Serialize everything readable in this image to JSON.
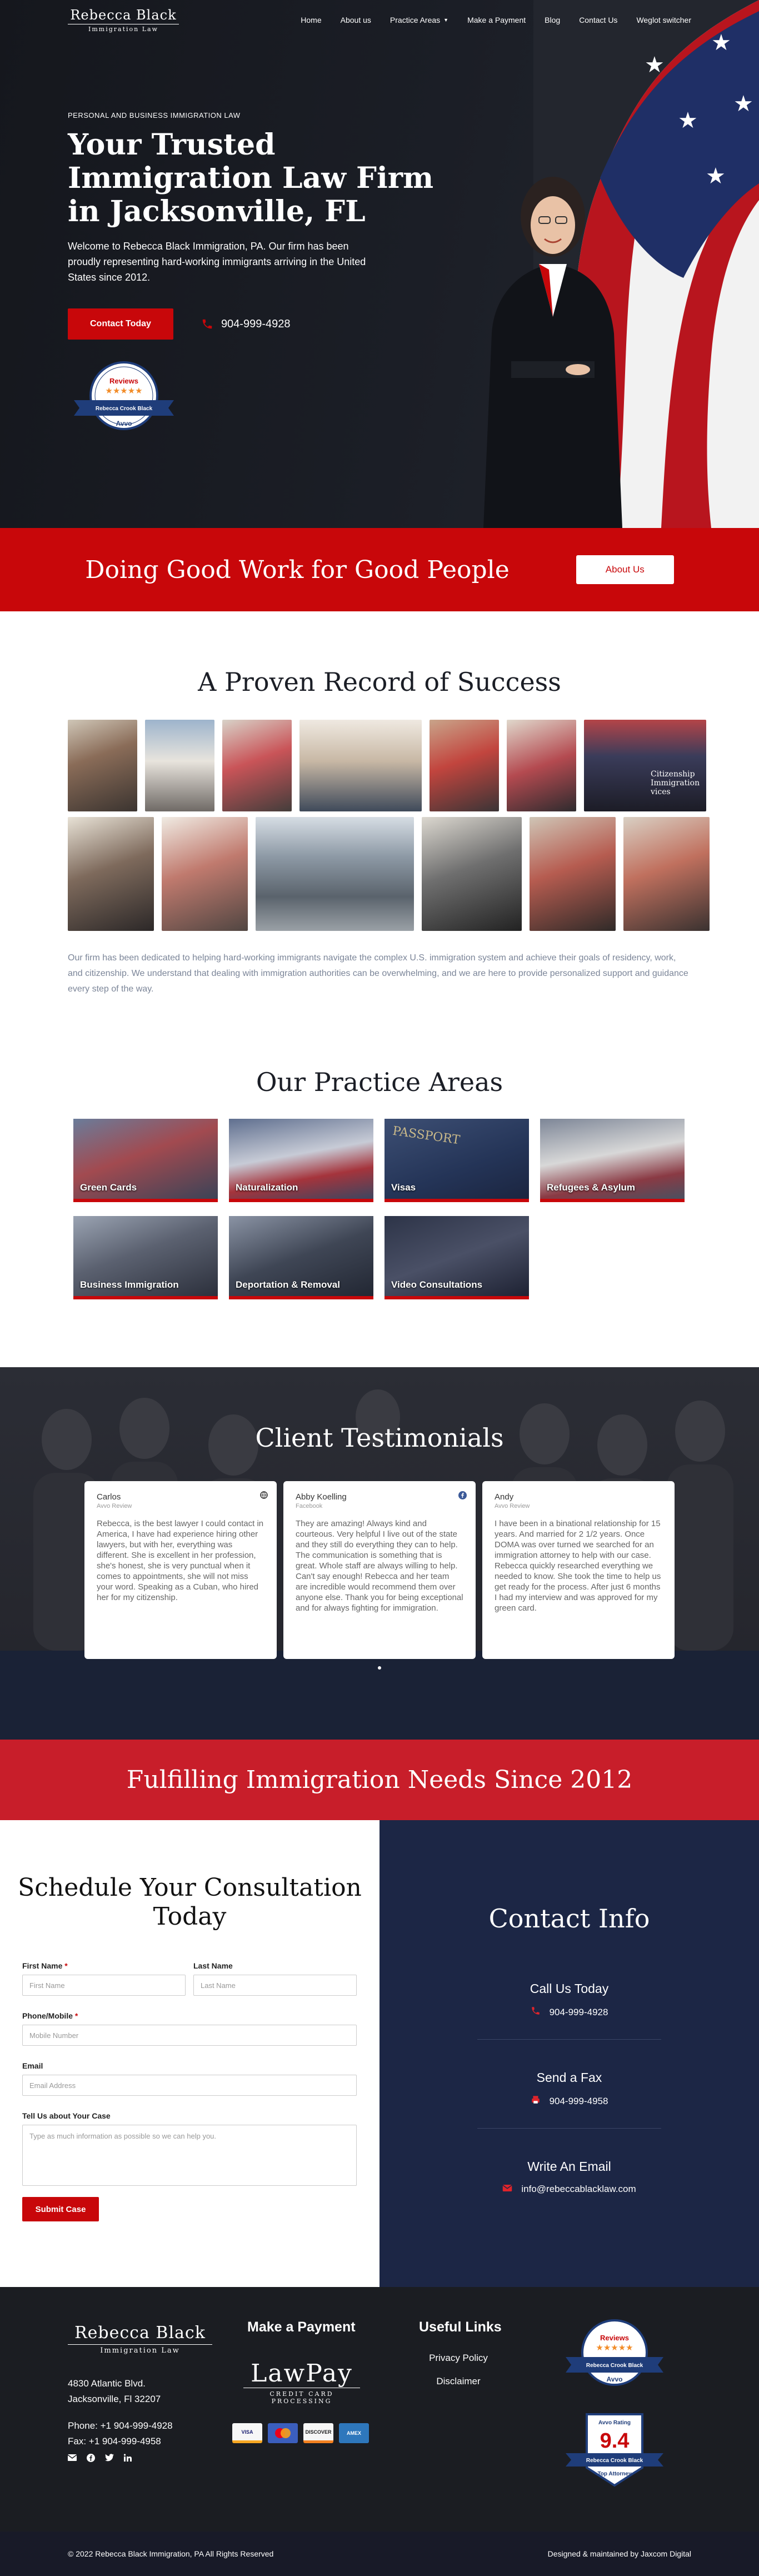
{
  "header": {
    "logo_line1": "Rebecca Black",
    "logo_line2": "Immigration Law",
    "nav": [
      "Home",
      "About us",
      "Practice Areas",
      "Make a Payment",
      "Blog",
      "Contact Us",
      "Weglot switcher"
    ]
  },
  "hero": {
    "subtitle": "PERSONAL AND BUSINESS IMMIGRATION LAW",
    "title": "Your Trusted Immigration Law Firm in Jacksonville, FL",
    "paragraph": "Welcome to Rebecca Black Immigration, PA. Our firm has been proudly representing hard-working immigrants arriving in the United States since 2012.",
    "cta_label": "Contact Today",
    "phone": "904-999-4928",
    "badge_top": "Reviews",
    "badge_name": "Rebecca Crook Black",
    "badge_brand": "Avvo",
    "stars": "★★★★★"
  },
  "banner1": {
    "title": "Doing Good Work for Good People",
    "button": "About Us"
  },
  "proven": {
    "title": "A Proven Record of Success",
    "paragraph": "Our firm has been dedicated to helping hard-working immigrants navigate the complex U.S. immigration system and achieve their goals of residency, work, and citizenship. We understand that dealing with immigration authorities can be overwhelming, and we are here to provide personalized support and guidance every step of the way.",
    "photo_sign_text": "Citizenship Immigration vices"
  },
  "practice": {
    "title": "Our Practice Areas",
    "areas": [
      "Green Cards",
      "Naturalization",
      "Visas",
      "Refugees & Asylum",
      "Business Immigration",
      "Deportation & Removal",
      "Video Consultations"
    ],
    "passport_text": "PASSPORT"
  },
  "testimonials": {
    "title": "Client Testimonials",
    "cards": [
      {
        "name": "Carlos",
        "source": "Avvo Review",
        "text": "Rebecca, is the best lawyer I could contact in America, I have had experience hiring other lawyers, but with her, everything was different. She is excellent in her profession, she's honest, she is very punctual when it comes to appointments, she will not miss your word. Speaking as a Cuban, who hired her for my citizenship."
      },
      {
        "name": "Abby Koelling",
        "source": "Facebook",
        "text": "They are amazing! Always kind and courteous. Very helpful I live out of the state and they still do everything they can to help. The communication is something that is great. Whole staff are always willing to help. Can't say enough! Rebecca and her team are incredible would recommend them over anyone else. Thank you for being exceptional and for always fighting for immigration."
      },
      {
        "name": "Andy",
        "source": "Avvo Review",
        "text": "I have been in a binational relationship for 15 years. And married for 2 1/2 years. Once DOMA was over turned we searched for an immigration attorney to help with our case. Rebecca quickly researched everything we needed to know. She took the time to help us get ready for the process. After just 6 months I had my interview and was approved for my green card."
      }
    ]
  },
  "banner2": {
    "title": "Fulfilling Immigration Needs Since 2012"
  },
  "form": {
    "title": "Schedule Your Consultation Today",
    "first_label": "First Name",
    "first_placeholder": "First Name",
    "last_label": "Last Name",
    "last_placeholder": "Last Name",
    "phone_label": "Phone/Mobile",
    "phone_placeholder": "Mobile Number",
    "email_label": "Email",
    "email_placeholder": "Email Address",
    "case_label": "Tell Us about Your Case",
    "case_placeholder": "Type as much information as possible so we can help you.",
    "required": "*",
    "submit": "Submit Case"
  },
  "contact": {
    "title": "Contact Info",
    "call_heading": "Call Us Today",
    "call_value": "904-999-4928",
    "fax_heading": "Send a Fax",
    "fax_value": "904-999-4958",
    "email_heading": "Write An Email",
    "email_value": "info@rebeccablacklaw.com"
  },
  "footer": {
    "logo_line1": "Rebecca Black",
    "logo_line2": "Immigration Law",
    "address1": "4830 Atlantic Blvd.",
    "address2": "Jacksonville, Fl 32207",
    "phone": "Phone: +1 904-999-4928",
    "fax": "Fax: +1 904-999-4958",
    "payment_heading": "Make a Payment",
    "lawpay_name": "LawPay",
    "lawpay_sub": "CREDIT CARD PROCESSING",
    "card_names": [
      "VISA",
      "Mastercard",
      "DISCOVER",
      "AMEX"
    ],
    "links_heading": "Useful Links",
    "links": [
      "Privacy Policy",
      "Disclaimer"
    ],
    "badge_reviews": "Reviews",
    "badge_name": "Rebecca Crook Black",
    "badge_brand": "Avvo",
    "rating_label": "Avvo Rating",
    "rating": "9.4",
    "rating_caption": "Top Attorney",
    "copyright": "© 2022 Rebecca Black Immigration, PA All Rights Reserved",
    "credit": "Designed & maintained by Jaxcom Digital"
  },
  "colors": {
    "brand_red": "#c8070a",
    "navy": "#1c2645",
    "dark": "#1b1e26"
  }
}
